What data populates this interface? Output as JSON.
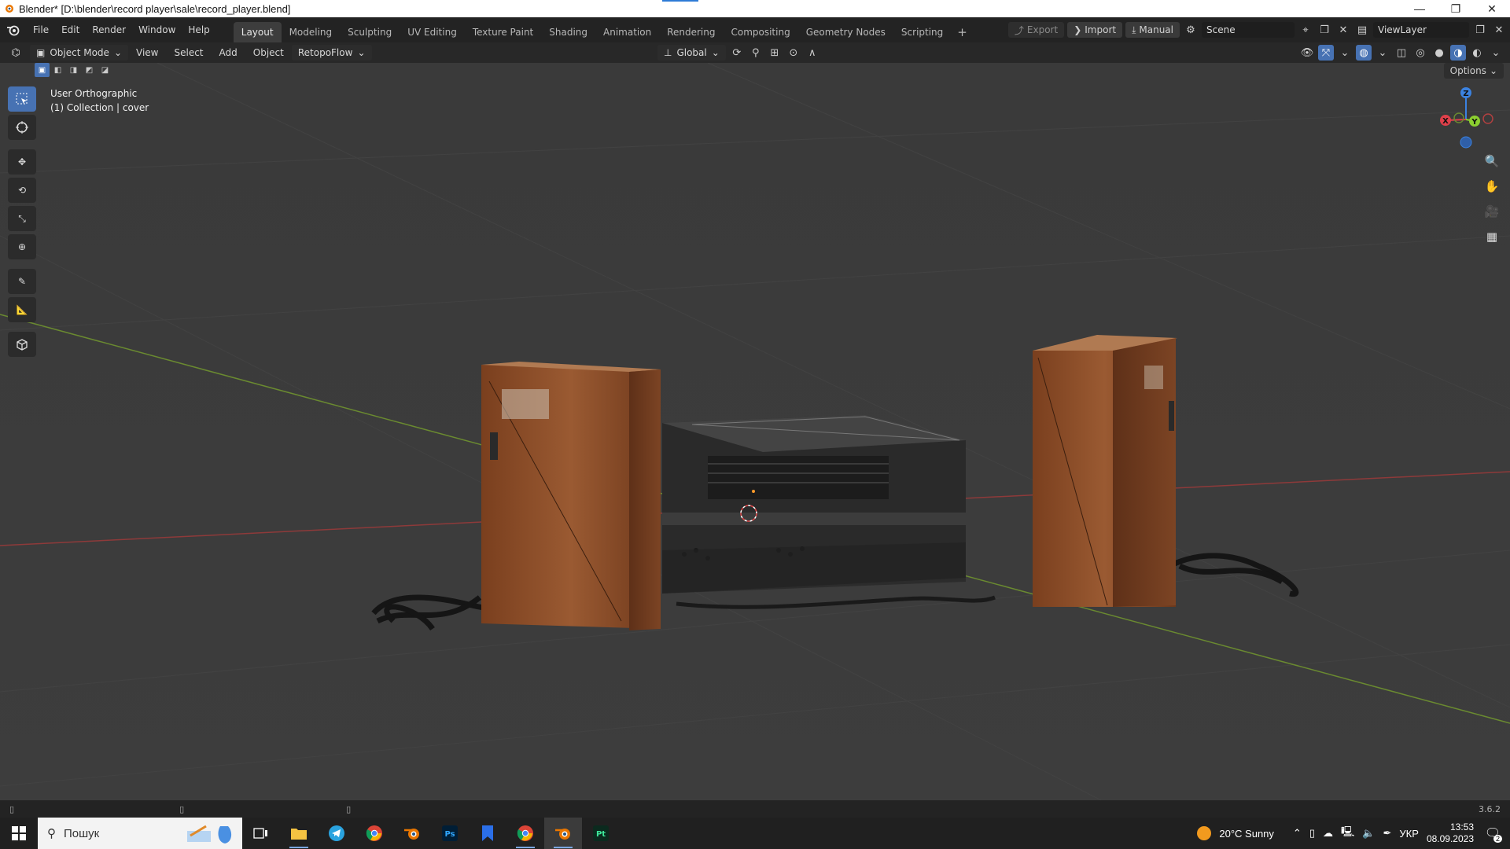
{
  "window": {
    "title": "Blender* [D:\\blender\\record player\\sale\\record_player.blend]",
    "controls": [
      "—",
      "❐",
      "✕"
    ]
  },
  "menubar": {
    "items": [
      "File",
      "Edit",
      "Render",
      "Window",
      "Help"
    ]
  },
  "workspaces": {
    "tabs": [
      "Layout",
      "Modeling",
      "Sculpting",
      "UV Editing",
      "Texture Paint",
      "Shading",
      "Animation",
      "Rendering",
      "Compositing",
      "Geometry Nodes",
      "Scripting"
    ],
    "active": "Layout",
    "add": "+"
  },
  "topright": {
    "export": "Export",
    "import": "Import",
    "manual": "Manual",
    "scene": "Scene",
    "view_layer": "ViewLayer"
  },
  "header": {
    "mode": "Object Mode",
    "menus": [
      "View",
      "Select",
      "Add",
      "Object"
    ],
    "addon": "RetopoFlow",
    "orientation": "Global"
  },
  "viewport": {
    "view_name": "User Orthographic",
    "collection": "(1) Collection | cover",
    "options": "Options",
    "gizmo": {
      "z": "Z",
      "y": "Y",
      "x": "X"
    }
  },
  "colors": {
    "accent": "#4772b3",
    "x_axis": "#e0404a",
    "y_axis": "#8ccf30",
    "z_axis": "#3b82e0",
    "wood": "#8a4a26"
  },
  "statusbar": {
    "version": "3.6.2"
  },
  "taskbar": {
    "search_placeholder": "Пошук",
    "weather": "20°C  Sunny",
    "language": "УКР",
    "time": "13:53",
    "date": "08.09.2023",
    "notification_count": "2"
  }
}
